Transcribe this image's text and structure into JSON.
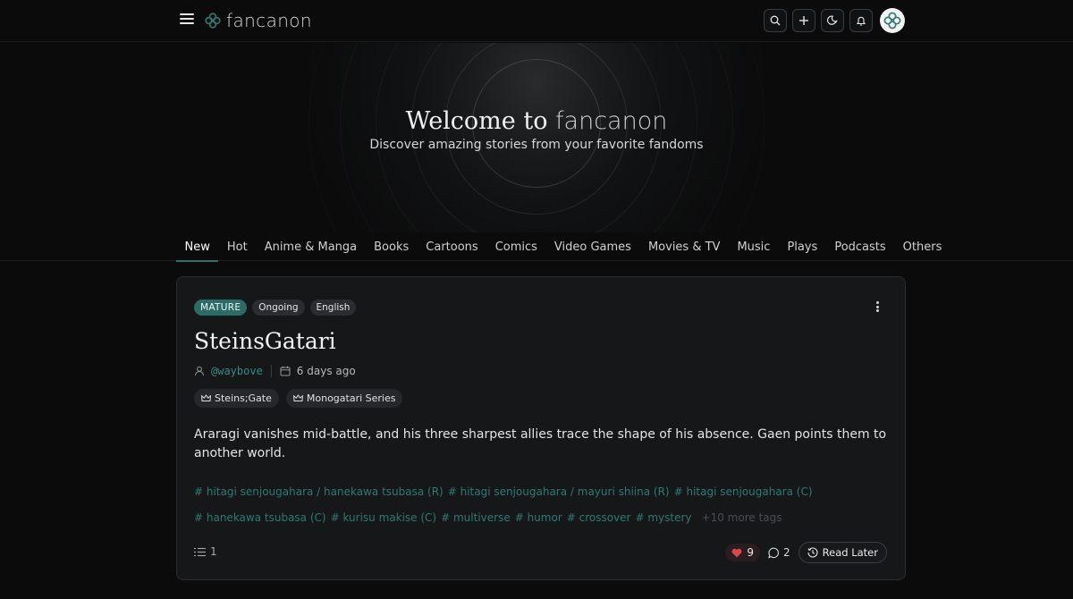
{
  "header": {
    "brand": "fancanon",
    "menu_icon": "hamburger-menu-icon",
    "logo_icon": "clover-logo-icon",
    "actions": [
      {
        "name": "search",
        "icon": "search-icon"
      },
      {
        "name": "create",
        "icon": "plus-icon"
      },
      {
        "name": "theme",
        "icon": "moon-icon"
      },
      {
        "name": "notifications",
        "icon": "bell-icon"
      }
    ],
    "avatar_icon": "clover-avatar-icon"
  },
  "hero": {
    "title_prefix": "Welcome to",
    "title_brand": "fancanon",
    "subtitle": "Discover amazing stories from your favorite fandoms"
  },
  "tabs": [
    "New",
    "Hot",
    "Anime & Manga",
    "Books",
    "Cartoons",
    "Comics",
    "Video Games",
    "Movies & TV",
    "Music",
    "Plays",
    "Podcasts",
    "Others"
  ],
  "active_tab": "New",
  "story": {
    "badges": [
      "MATURE",
      "Ongoing",
      "English"
    ],
    "title": "SteinsGatari",
    "author": "@waybove",
    "date": "6 days ago",
    "fandoms": [
      "Steins;Gate",
      "Monogatari Series"
    ],
    "summary": "Araragi vanishes mid-battle, and his three sharpest allies trace the shape of his absence. Gaen points them to another world.",
    "tags": [
      "# hitagi senjougahara / hanekawa tsubasa (R)",
      "# hitagi senjougahara / mayuri shiina (R)",
      "# hitagi senjougahara (C)",
      "# hanekawa tsubasa (C)",
      "# kurisu makise (C)",
      "# multiverse",
      "# humor",
      "# crossover",
      "# mystery"
    ],
    "more_tags": "+10 more tags",
    "chapters": "1",
    "likes": "9",
    "comments": "2",
    "read_later": "Read Later"
  },
  "colors": {
    "accent": "#2d6b67",
    "tag": "#2f7a73",
    "author": "#3a8c85",
    "like": "#e0454f"
  }
}
